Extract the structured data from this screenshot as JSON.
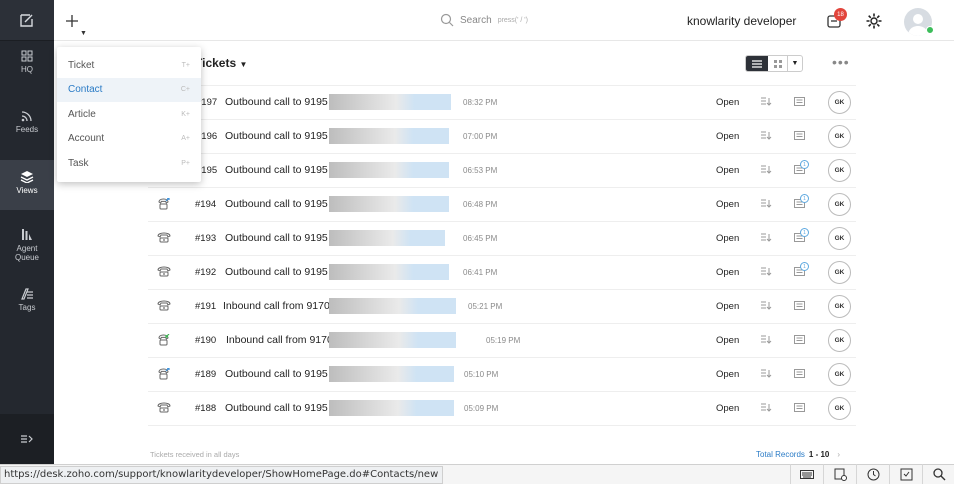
{
  "topbar": {
    "search_label": "Search",
    "search_hint": "press(' / ')",
    "user_label": "knowlarity developer",
    "notif_count": "18"
  },
  "sidebar": {
    "items": [
      {
        "label": "HQ"
      },
      {
        "label": "Feeds"
      },
      {
        "label": "Views"
      },
      {
        "label": "Agent Queue"
      },
      {
        "label": "Tags"
      }
    ]
  },
  "create_menu": {
    "items": [
      {
        "label": "Ticket",
        "key": "T+"
      },
      {
        "label": "Contact",
        "key": "C+"
      },
      {
        "label": "Article",
        "key": "K+"
      },
      {
        "label": "Account",
        "key": "A+"
      },
      {
        "label": "Task",
        "key": "P+"
      }
    ]
  },
  "view": {
    "title": "Tickets"
  },
  "tickets": [
    {
      "num": "#197",
      "subject": "Outbound call to 9195",
      "time": "08:32 PM",
      "status": "Open",
      "assignee": "GK",
      "conv": ""
    },
    {
      "num": "#196",
      "subject": "Outbound call to 9195",
      "time": "07:00 PM",
      "status": "Open",
      "assignee": "GK",
      "conv": ""
    },
    {
      "num": "#195",
      "subject": "Outbound call to 9195",
      "time": "06:53 PM",
      "status": "Open",
      "assignee": "GK",
      "conv": "1"
    },
    {
      "num": "#194",
      "subject": "Outbound call to 9195",
      "time": "06:48 PM",
      "status": "Open",
      "assignee": "GK",
      "conv": "1"
    },
    {
      "num": "#193",
      "subject": "Outbound call to 9195",
      "time": "06:45 PM",
      "status": "Open",
      "assignee": "GK",
      "conv": "1"
    },
    {
      "num": "#192",
      "subject": "Outbound call to 9195",
      "time": "06:41 PM",
      "status": "Open",
      "assignee": "GK",
      "conv": "1"
    },
    {
      "num": "#191",
      "subject": "Inbound call from 9170",
      "time": "05:21 PM",
      "status": "Open",
      "assignee": "GK",
      "conv": ""
    },
    {
      "num": "#190",
      "subject": "Inbound call from 9170",
      "time": "05:19 PM",
      "status": "Open",
      "assignee": "GK",
      "conv": ""
    },
    {
      "num": "#189",
      "subject": "Outbound call to 9195",
      "time": "05:10 PM",
      "status": "Open",
      "assignee": "GK",
      "conv": ""
    },
    {
      "num": "#188",
      "subject": "Outbound call to 9195",
      "time": "05:09 PM",
      "status": "Open",
      "assignee": "GK",
      "conv": ""
    }
  ],
  "footer": {
    "left": "Tickets received in all days",
    "total_label": "Total Records",
    "range": "1 - 10"
  },
  "status_url": "https://desk.zoho.com/support/knowlaritydeveloper/ShowHomePage.do#Contacts/new"
}
